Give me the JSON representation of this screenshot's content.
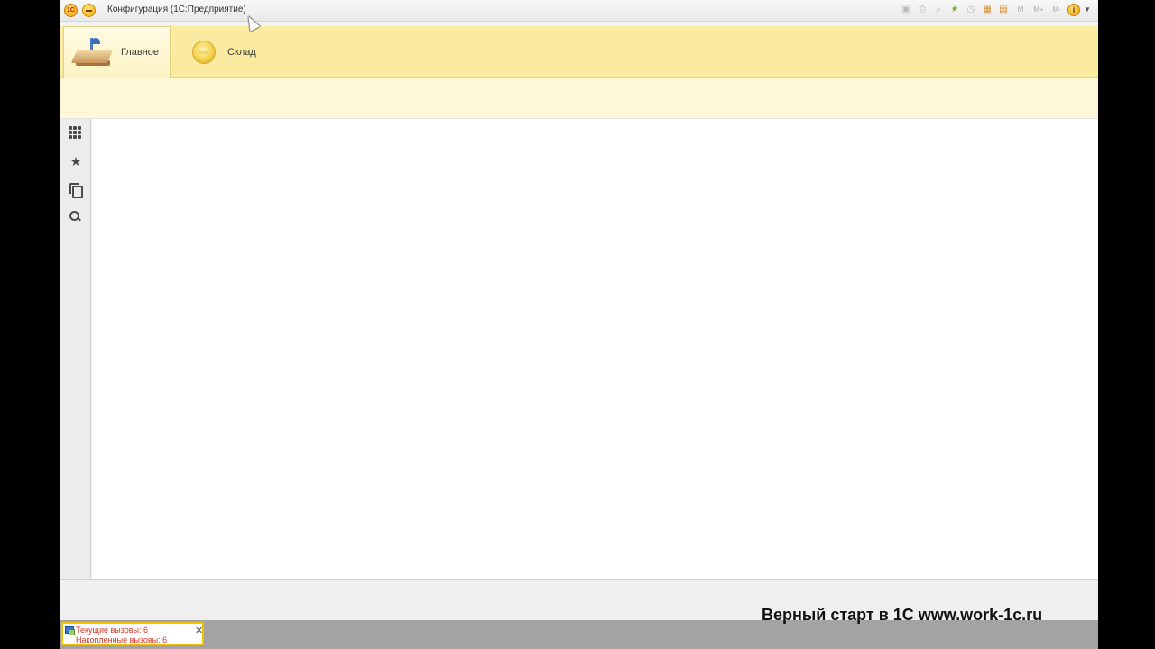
{
  "window": {
    "title": "Конфигурация  (1С:Предприятие)",
    "logo_text": "1С"
  },
  "toolbar_icons": [
    "save-icon",
    "print-icon",
    "preview-icon",
    "add-favorite-icon",
    "history-icon",
    "calculator-icon",
    "calendar-icon",
    "m-icon",
    "m-plus-icon",
    "m-minus-icon",
    "info-icon"
  ],
  "toolbar_memory": {
    "m": "M",
    "m_plus": "M+",
    "m_minus": "M-"
  },
  "sections": [
    {
      "label": "Главное",
      "icon": "desk-lamp-icon",
      "active": true
    },
    {
      "label": "Склад",
      "icon": "sklad-icon",
      "active": false
    }
  ],
  "left_panel": [
    "functions-menu-icon",
    "favorites-star-icon",
    "history-icon",
    "search-icon"
  ],
  "perf_panel": {
    "current_calls": "Текущие вызовы: 6",
    "accumulated_calls": "Накопленные вызовы: 6"
  },
  "watermark": "Верный старт в 1С www.work-1c.ru",
  "colors": {
    "sections_bg": "#fbeba1",
    "cmdbar_bg": "#fff8d6",
    "perf_text": "#d23a2a",
    "perf_border": "#f2c200"
  }
}
